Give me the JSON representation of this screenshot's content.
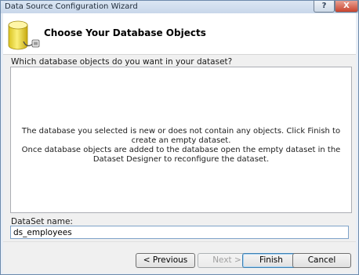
{
  "window": {
    "title": "Data Source Configuration Wizard",
    "help_glyph": "?",
    "close_glyph": "X"
  },
  "header": {
    "title": "Choose Your Database Objects",
    "icon": "database-icon"
  },
  "main": {
    "question": "Which database objects do you want in your dataset?",
    "empty_message_line1": "The database you selected is new or does not contain any objects. Click Finish to create an empty dataset.",
    "empty_message_line2": "Once database objects are added to the database open the empty dataset in the Dataset Designer to reconfigure the dataset."
  },
  "dataset": {
    "label": "DataSet name:",
    "value": "ds_employees"
  },
  "buttons": {
    "previous": "< Previous",
    "next": "Next >",
    "finish": "Finish",
    "cancel": "Cancel"
  }
}
